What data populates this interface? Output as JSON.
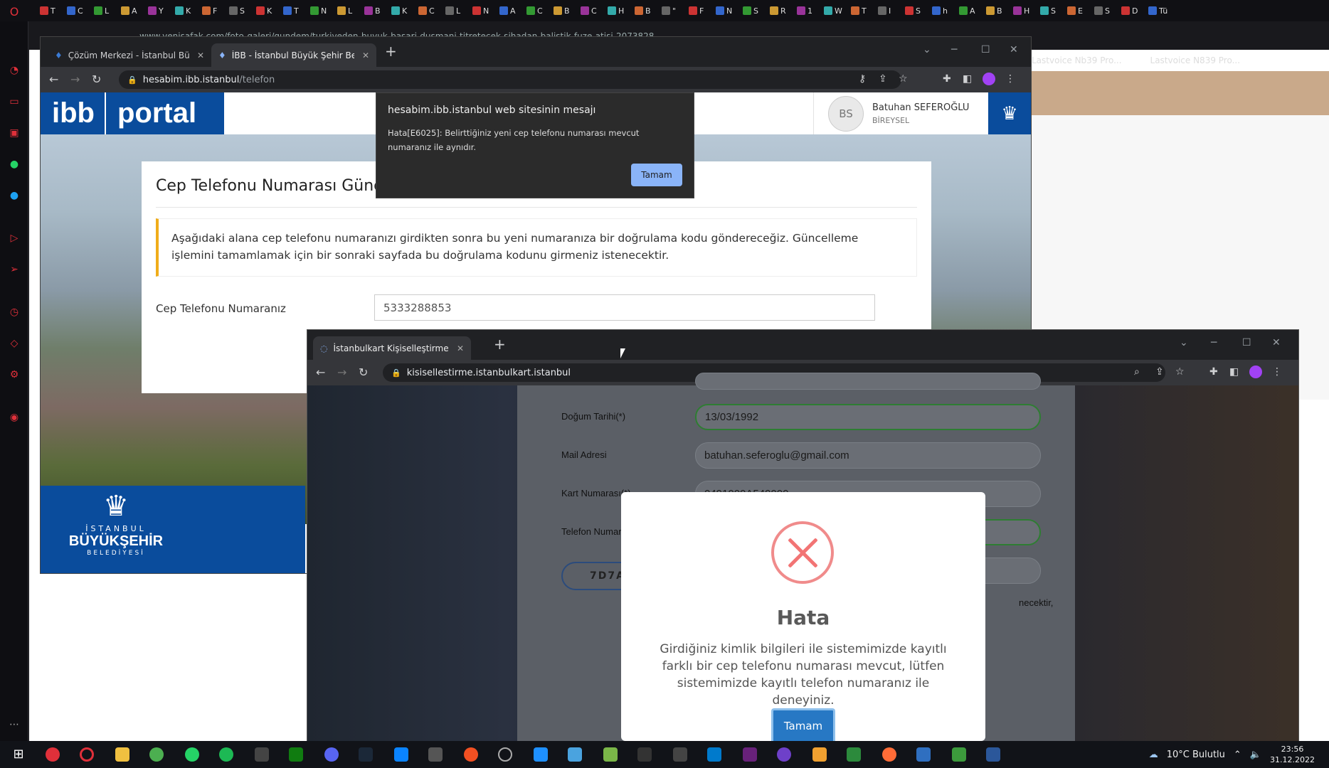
{
  "opera": {
    "address": "www.yenisafak.com/foto-galeri/gundem/turkiyeden-buyuk-basari-dusmani-titretecek-sihadan-balistik-fuze-atisi-2073828",
    "bookmarks": [
      "Lastvoice Nb39 Pro...",
      "Lastvoice N839 Pro..."
    ],
    "tab_labels": [
      "T",
      "C",
      "L",
      "A",
      "Y",
      "K",
      "F",
      "S",
      "K",
      "T",
      "N",
      "L",
      "B",
      "K",
      "C",
      "L",
      "N",
      "A",
      "C",
      "B",
      "C",
      "H",
      "B",
      "\"",
      "F",
      "N",
      "S",
      "R",
      "1",
      "W",
      "T",
      "I",
      "S",
      "h",
      "A",
      "B",
      "H",
      "S",
      "E",
      "S",
      "D",
      "Tü"
    ]
  },
  "window1": {
    "tabs": [
      {
        "label": "Çözüm Merkezi - İstanbul Büyük"
      },
      {
        "label": "İBB - İstanbul Büyük Şehir Beledi"
      }
    ],
    "url_host": "hesabim.ibb.istanbul",
    "url_path": "/telefon",
    "logo_a": "ibb",
    "logo_b": "portal",
    "user": {
      "initials": "BS",
      "name": "Batuhan SEFEROĞLU",
      "role": "BİREYSEL"
    },
    "card_title": "Cep Telefonu Numarası Güncelleme",
    "note": "Aşağıdaki alana cep telefonu numaranızı girdikten sonra bu yeni numaranıza bir doğrulama kodu göndereceğiz. Güncelleme işlemini tamamlamak için bir sonraki sayfada bu doğrulama kodunu girmeniz istenecektir.",
    "phone_label": "Cep Telefonu Numaranız",
    "phone_value": "5333288853",
    "footer_logo": {
      "line1": "İSTANBUL",
      "line2": "BÜYÜKŞEHİR",
      "line3": "BELEDİYESİ"
    }
  },
  "alert": {
    "title": "hesabim.ibb.istanbul web sitesinin mesajı",
    "message": "Hata[E6025]: Belirttiğiniz yeni cep telefonu numarası mevcut numaranız ile aynıdır.",
    "ok": "Tamam"
  },
  "window2": {
    "tab_label": "İstanbulkart Kişiselleştirme",
    "url": "kisisellestirme.istanbulkart.istanbul",
    "form": {
      "dob_label": "Doğum Tarihi(*)",
      "dob_value": "13/03/1992",
      "mail_label": "Mail Adresi",
      "mail_value": "batuhan.seferoglu@gmail.com",
      "card_label": "Kart Numarası(*)",
      "card_value": "0491000A549000",
      "phone_label": "Telefon Numar",
      "captcha": "7D7A",
      "trail_text": "necektir,"
    }
  },
  "modal": {
    "title": "Hata",
    "message": "Girdiğiniz kimlik bilgileri ile sistemimizde kayıtlı farklı bir cep telefonu numarası mevcut, lütfen sistemimizde kayıtlı telefon numaranız ile deneyiniz.",
    "ok": "Tamam"
  },
  "taskbar": {
    "weather": "10°C  Bulutlu",
    "time": "23:56",
    "date": "31.12.2022"
  },
  "colors": {
    "ibb_blue": "#0a4c9c",
    "alert_btn": "#8ab4f8",
    "modal_btn": "#2778c4",
    "error_red": "#f27474"
  }
}
